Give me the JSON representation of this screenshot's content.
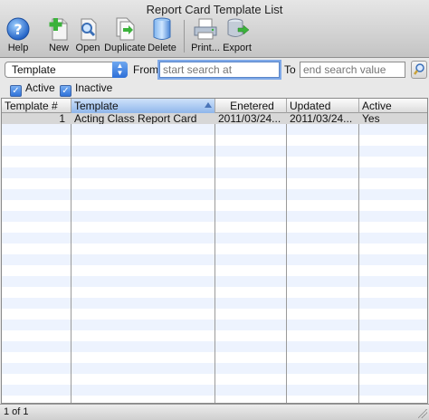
{
  "window": {
    "title": "Report Card Template List"
  },
  "toolbar": {
    "help": "Help",
    "new": "New",
    "open": "Open",
    "duplicate": "Duplicate",
    "delete": "Delete",
    "print": "Print...",
    "export": "Export"
  },
  "icons": {
    "help": "help-icon",
    "new": "new-document-icon",
    "open": "open-document-icon",
    "duplicate": "duplicate-document-icon",
    "delete": "trash-can-icon",
    "print": "printer-icon",
    "export": "export-database-icon",
    "search": "magnifier-icon"
  },
  "filter": {
    "field_selected": "Template",
    "from_label": "From",
    "from_placeholder": "start search at",
    "to_label": "To",
    "to_placeholder": "end search value",
    "active_label": "Active",
    "inactive_label": "Inactive",
    "active_checked": true,
    "inactive_checked": true
  },
  "table": {
    "columns": [
      "Template #",
      "Template",
      "Enetered",
      "Updated",
      "Active"
    ],
    "sorted_column": "Template",
    "rows": [
      {
        "number": "1",
        "template": "Acting Class Report Card",
        "entered": "2011/03/24...",
        "updated": "2011/03/24...",
        "active": "Yes"
      }
    ]
  },
  "footer": {
    "record_count": "1 of 1"
  },
  "colors": {
    "accent": "#2f72d9",
    "stripe": "#edf3fe",
    "selected_row": "#d7d7d7"
  }
}
